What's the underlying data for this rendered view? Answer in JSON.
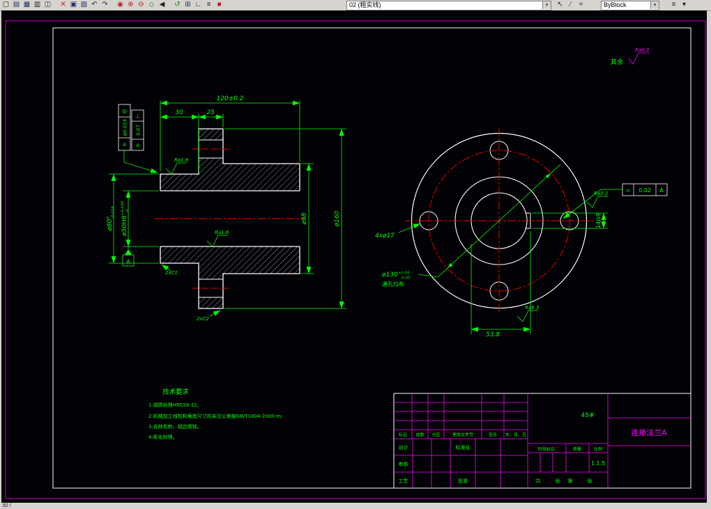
{
  "window": {
    "statusbar_left": "82 /"
  },
  "toolbar": {
    "layer_select": "02 (粗实线)",
    "style_select": "ByBlock",
    "combo_arrow": "▾",
    "icons": [
      {
        "name": "new",
        "glyph": "▢"
      },
      {
        "name": "open",
        "glyph": "▤"
      },
      {
        "name": "save",
        "glyph": "▦"
      },
      {
        "name": "print",
        "glyph": "▥"
      },
      {
        "name": "preview",
        "glyph": "◫"
      },
      {
        "name": "cut",
        "glyph": "✕"
      },
      {
        "name": "copy",
        "glyph": "▣"
      },
      {
        "name": "paste",
        "glyph": "▨"
      },
      {
        "name": "undo",
        "glyph": "↶"
      },
      {
        "name": "redo",
        "glyph": "↷"
      },
      {
        "name": "zoom-all",
        "glyph": "◉"
      },
      {
        "name": "zoom-in",
        "glyph": "⊕"
      },
      {
        "name": "zoom-out",
        "glyph": "⊖"
      },
      {
        "name": "pan",
        "glyph": "◇"
      },
      {
        "name": "prev-view",
        "glyph": "◀"
      },
      {
        "name": "refresh",
        "glyph": "↺"
      },
      {
        "name": "grid",
        "glyph": "⊞"
      },
      {
        "name": "ortho",
        "glyph": "∟"
      },
      {
        "name": "layers",
        "glyph": "≡"
      },
      {
        "name": "color",
        "glyph": "■"
      },
      {
        "name": "pick-arrow",
        "glyph": "↖"
      },
      {
        "name": "pen",
        "glyph": "∕"
      },
      {
        "name": "linewidth",
        "glyph": "="
      },
      {
        "name": "list",
        "glyph": "≡"
      },
      {
        "name": "menu-down",
        "glyph": "▾"
      }
    ]
  },
  "drawing": {
    "general_note": {
      "label": "其余",
      "value": "Ra6.3"
    },
    "section": {
      "dim_length": "120±0.2",
      "dim_seg1": "30",
      "dim_seg2": "25",
      "dim_d160": "ø160",
      "dim_d98": "ø98",
      "dim_d80": {
        "main": "ø80",
        "sup": "0",
        "sub": "-0.019"
      },
      "dim_d50": {
        "main": "ø50H8",
        "sup": "+0.039",
        "sub": "0"
      },
      "chamfer1": "2xC1",
      "chamfer2": "2xC2",
      "fcf1": {
        "sym": "◎",
        "val": "ø0.024",
        "datum": "A"
      },
      "fcf2": {
        "sym": "⊥",
        "val": "0.07",
        "datum": "A"
      },
      "datum_label": "A",
      "rough1": "Ra1.6",
      "rough2": "Ra1.6"
    },
    "front": {
      "holes_label": "4xø17",
      "bcd": {
        "main": "ø130",
        "sup": "+0.05",
        "sub": "-0.05"
      },
      "holes_note": "通孔均布",
      "keyway_width": "14Js9",
      "keyway_depth": "53.8",
      "rough_top": "Ra3.2",
      "rough_bottom": "Ra6.3",
      "fcf": {
        "sym": "=",
        "val": "0.02",
        "datum": "A"
      }
    },
    "tech": {
      "title": "技术要求",
      "line1": "1.调质处理HRC28-32。",
      "line2": "2.机械加工线性和角度尺寸的未注公差按GB/T1804-2000-m;",
      "line3": "3.去除毛刺，锐边倒钝。",
      "line4": "4.氧化处理。"
    },
    "titleblock": {
      "material": "45#",
      "part_name": "连接法兰A",
      "scale_value": "1:1.5",
      "h_biaoji": "标记",
      "h_chushu": "处数",
      "h_fenqu": "分区",
      "h_wenjian": "更改文件号",
      "h_qianming": "签名",
      "h_riqi": "年、月、日",
      "r_sheji": "设计",
      "r_shenhe": "审核",
      "r_gongyi": "工艺",
      "r_biaozhunhua": "标准化",
      "r_pizhun": "批准",
      "c_jieduan": "阶段标记",
      "c_zhiliang": "质量",
      "c_bili": "比例",
      "s_gong": "共",
      "s_zhang1": "张",
      "s_di": "第",
      "s_zhang2": "张"
    }
  }
}
